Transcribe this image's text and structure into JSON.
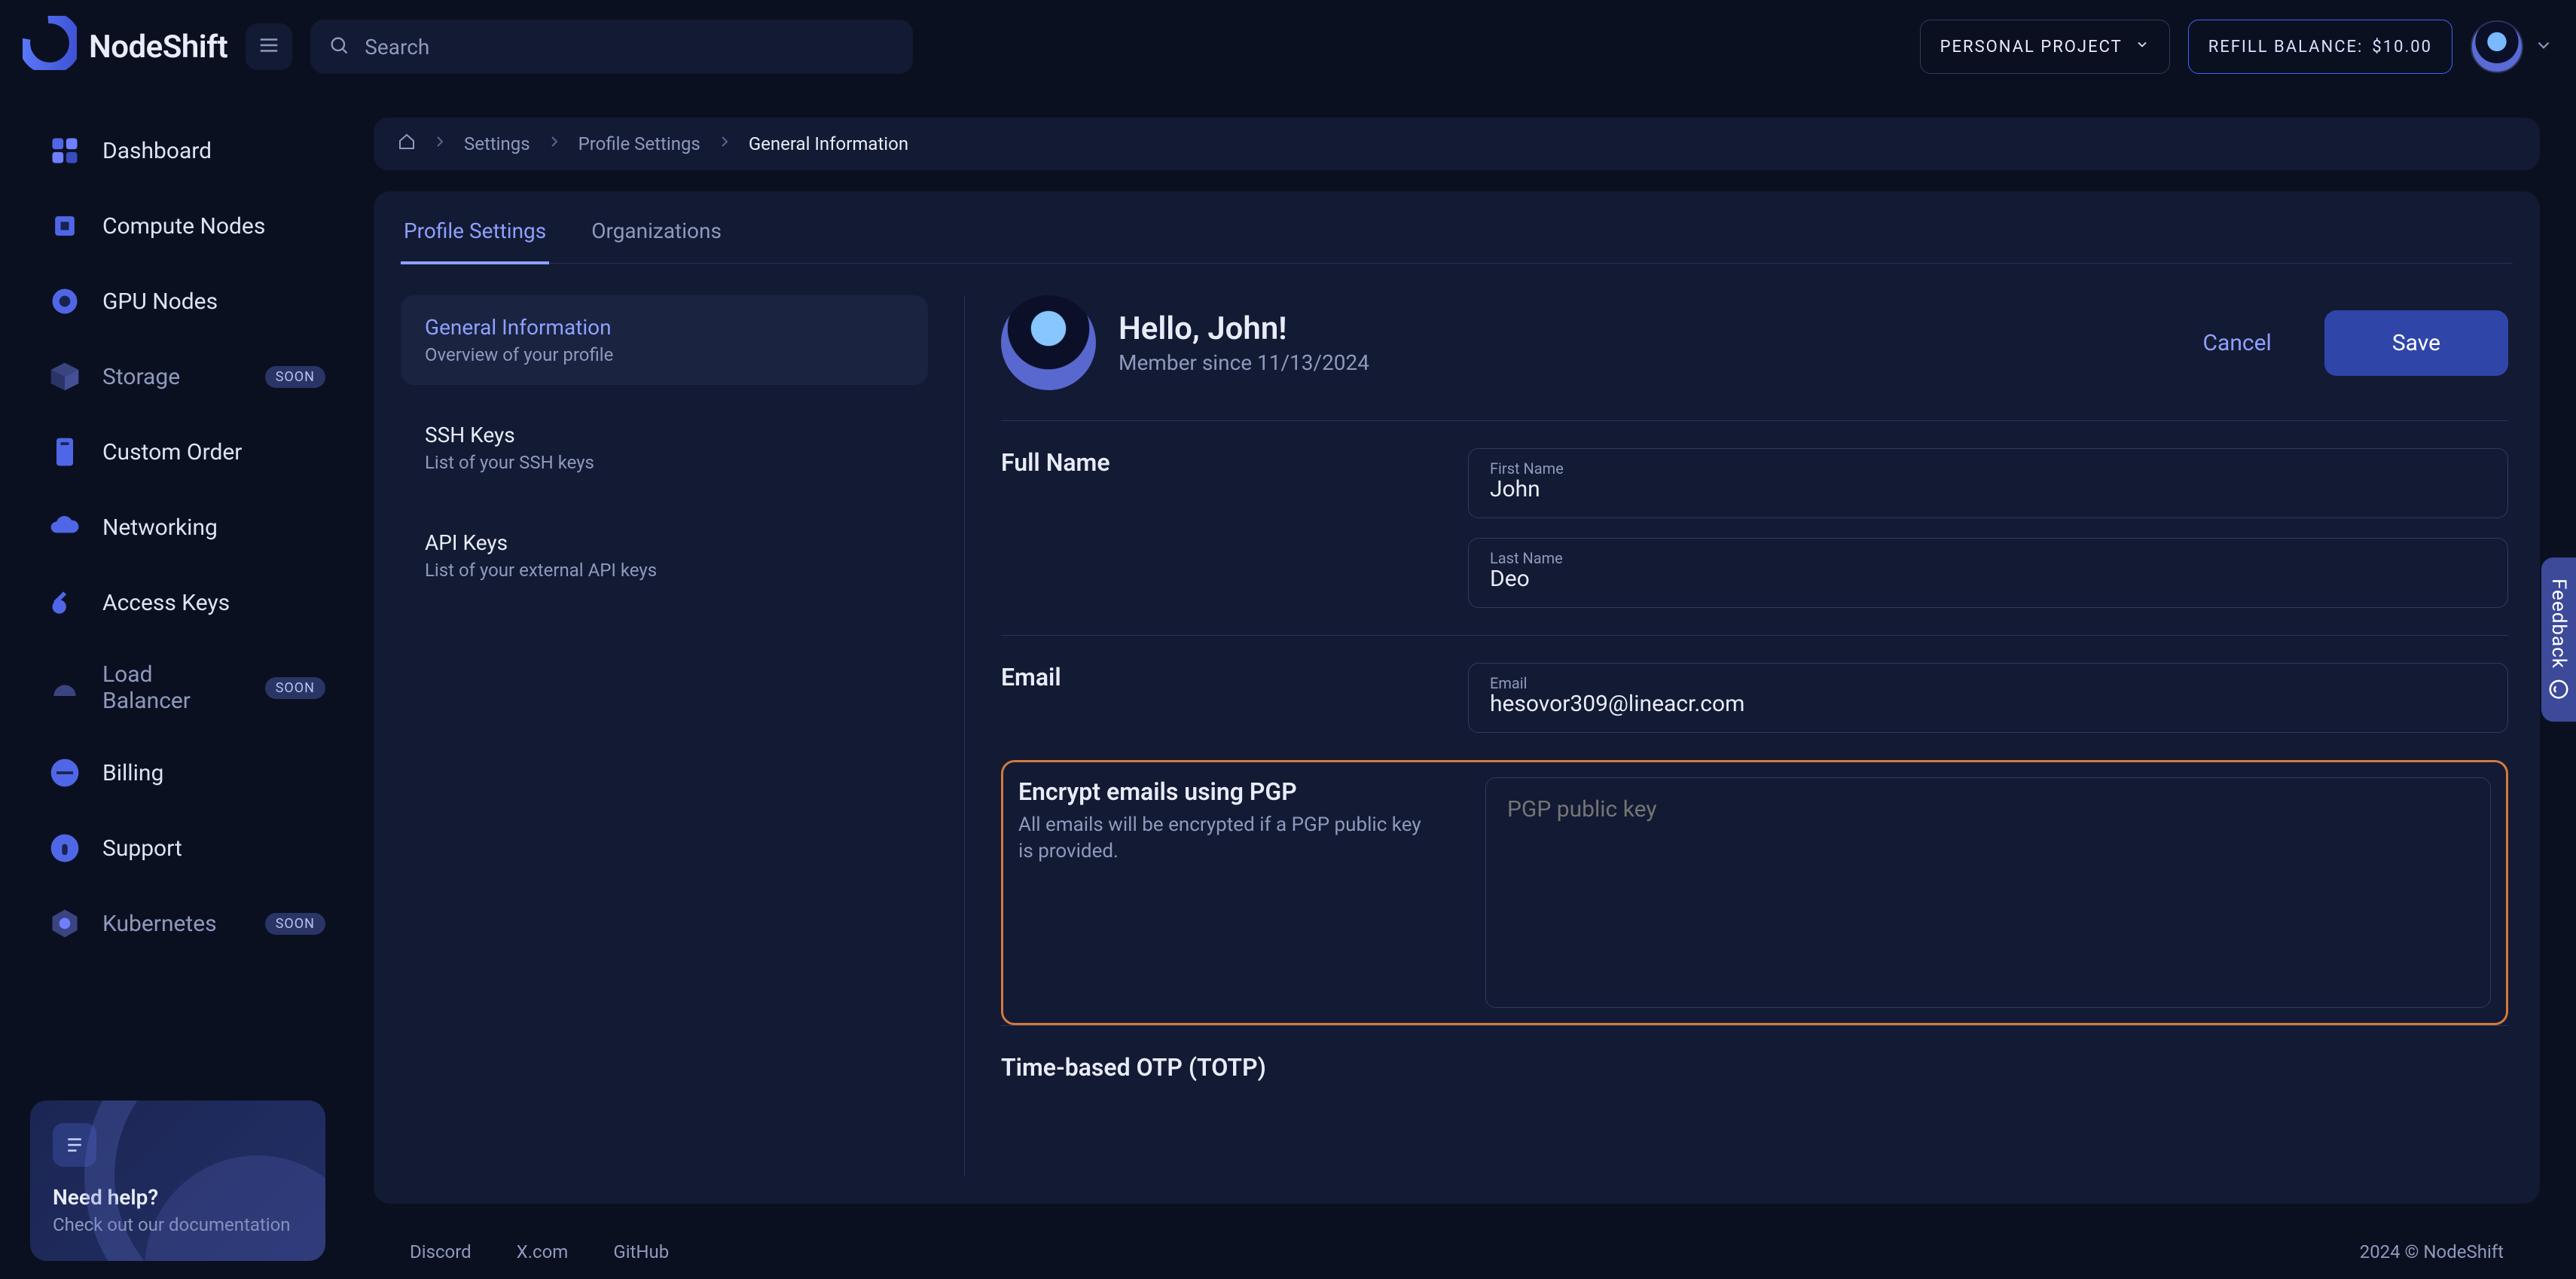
{
  "brand": {
    "name": "NodeShift"
  },
  "search": {
    "placeholder": "Search"
  },
  "header": {
    "project_label": "PERSONAL PROJECT",
    "refill_prefix": "REFILL BALANCE:",
    "refill_amount": "$10.00"
  },
  "sidebar": {
    "items": [
      {
        "label": "Dashboard",
        "icon": "dashboard"
      },
      {
        "label": "Compute Nodes",
        "icon": "cpu"
      },
      {
        "label": "GPU Nodes",
        "icon": "gpu"
      },
      {
        "label": "Storage",
        "icon": "storage",
        "badge": "SOON",
        "dim": true
      },
      {
        "label": "Custom Order",
        "icon": "custom"
      },
      {
        "label": "Networking",
        "icon": "cloud"
      },
      {
        "label": "Access Keys",
        "icon": "key"
      },
      {
        "label": "Load Balancer",
        "icon": "lb",
        "badge": "SOON",
        "dim": true
      },
      {
        "label": "Billing",
        "icon": "billing"
      },
      {
        "label": "Support",
        "icon": "support"
      },
      {
        "label": "Kubernetes",
        "icon": "k8s",
        "badge": "SOON",
        "dim": true
      }
    ],
    "help": {
      "title": "Need help?",
      "subtitle": "Check out our documentation"
    }
  },
  "breadcrumb": {
    "items": [
      "Settings",
      "Profile Settings",
      "General Information"
    ]
  },
  "tabs": {
    "profile": "Profile Settings",
    "orgs": "Organizations"
  },
  "subnav": [
    {
      "title": "General Information",
      "subtitle": "Overview of your profile",
      "active": true
    },
    {
      "title": "SSH Keys",
      "subtitle": "List of your SSH keys"
    },
    {
      "title": "API Keys",
      "subtitle": "List of your external API keys"
    }
  ],
  "profile": {
    "greeting": "Hello, John!",
    "member_since": "Member since 11/13/2024",
    "cancel": "Cancel",
    "save": "Save",
    "full_name_label": "Full Name",
    "first_name_label": "First Name",
    "first_name_value": "John",
    "last_name_label": "Last Name",
    "last_name_value": "Deo",
    "email_section_label": "Email",
    "email_label": "Email",
    "email_value": "hesovor309@lineacr.com",
    "pgp_title": "Encrypt emails using PGP",
    "pgp_subtitle": "All emails will be encrypted if a PGP public key is provided.",
    "pgp_placeholder": "PGP public key",
    "totp_title": "Time-based OTP (TOTP)"
  },
  "footer": {
    "links": [
      "Discord",
      "X.com",
      "GitHub"
    ],
    "copyright": "2024 © NodeShift"
  },
  "feedback": {
    "label": "Feedback"
  }
}
